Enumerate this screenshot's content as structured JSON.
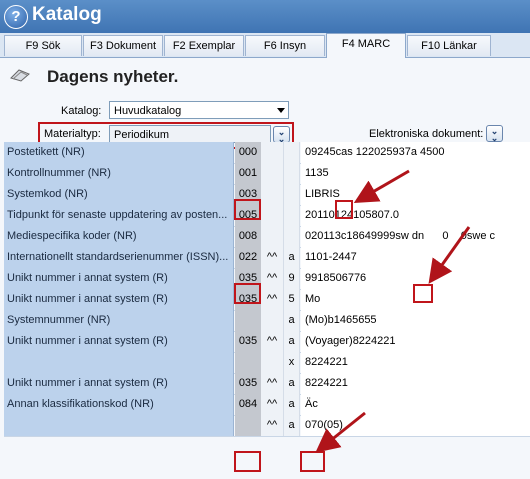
{
  "window": {
    "title": "Katalog"
  },
  "tabs": [
    {
      "label": "F9 Sök"
    },
    {
      "label": "F3 Dokument"
    },
    {
      "label": "F2 Exemplar"
    },
    {
      "label": "F6 Insyn"
    },
    {
      "label": "F4 MARC"
    },
    {
      "label": "F10 Länkar"
    }
  ],
  "page": {
    "title": "Dagens nyheter.",
    "katalog_label": "Katalog:",
    "katalog_value": "Huvudkatalog",
    "materialtyp_label": "Materialtyp:",
    "materialtyp_value": "Periodikum",
    "elektroniska_label": "Elektroniska dokument:"
  },
  "rows": [
    {
      "name": "Postetikett (NR)",
      "tag": "000",
      "ind": "",
      "sub": "",
      "val_pre": "09245",
      "val_hl": "cas",
      "val_post": " 122025937a 4500"
    },
    {
      "name": "Kontrollnummer (NR)",
      "tag": "001",
      "ind": "",
      "sub": "",
      "val_pre": "1135",
      "val_hl": "",
      "val_post": ""
    },
    {
      "name": "Systemkod (NR)",
      "tag": "003",
      "ind": "",
      "sub": "",
      "val_pre": "LIBRIS",
      "val_hl": "",
      "val_post": ""
    },
    {
      "name": "Tidpunkt för senaste uppdatering av posten...",
      "tag": "005",
      "ind": "",
      "sub": "",
      "val_pre": "20110124105807.0",
      "val_hl": "",
      "val_post": ""
    },
    {
      "name": "Mediespecifika koder (NR)",
      "tag": "008",
      "ind": "",
      "sub": "",
      "val_pre": "020113c18649999sw d",
      "val_hl": "n",
      "val_post": "      0    0swe c"
    },
    {
      "name": "Internationellt standardserienummer (ISSN)...",
      "tag": "022",
      "ind": "^^",
      "sub": "a",
      "val_pre": "1101-2447",
      "val_hl": "",
      "val_post": ""
    },
    {
      "name": "Unikt nummer i annat system (R)",
      "tag": "035",
      "ind": "^^",
      "sub": "9",
      "val_pre": "9918506776",
      "val_hl": "",
      "val_post": ""
    },
    {
      "name": "Unikt nummer i annat system (R)",
      "tag": "035",
      "ind": "^^",
      "sub": "5",
      "val_pre": "Mo",
      "val_hl": "",
      "val_post": ""
    },
    {
      "name": "  Systemnummer (NR)",
      "tag": "",
      "ind": "",
      "sub": "a",
      "val_pre": "(Mo)b1465655",
      "val_hl": "",
      "val_post": ""
    },
    {
      "name": "Unikt nummer i annat system (R)",
      "tag": "035",
      "ind": "^^",
      "sub": "a",
      "val_pre": "(Voyager)8224221",
      "val_hl": "",
      "val_post": ""
    },
    {
      "name": "",
      "tag": "",
      "ind": "",
      "sub": "x",
      "val_pre": "8224221",
      "val_hl": "",
      "val_post": ""
    },
    {
      "name": "Unikt nummer i annat system (R)",
      "tag": "035",
      "ind": "^^",
      "sub": "a",
      "val_pre": "8224221",
      "val_hl": "",
      "val_post": ""
    },
    {
      "name": "Annan klassifikationskod (NR)",
      "tag": "084",
      "ind": "^^",
      "sub": "a",
      "val_pre": "",
      "val_hl": "Äc",
      "val_post": ""
    },
    {
      "name": "",
      "tag": "",
      "ind": "^^",
      "sub": "a",
      "val_pre": "070(05)",
      "val_hl": "",
      "val_post": ""
    }
  ],
  "colors": {
    "accent": "#3f74b3",
    "highlight_red": "#c0151b",
    "row_label_bg": "#bcd2ec"
  }
}
